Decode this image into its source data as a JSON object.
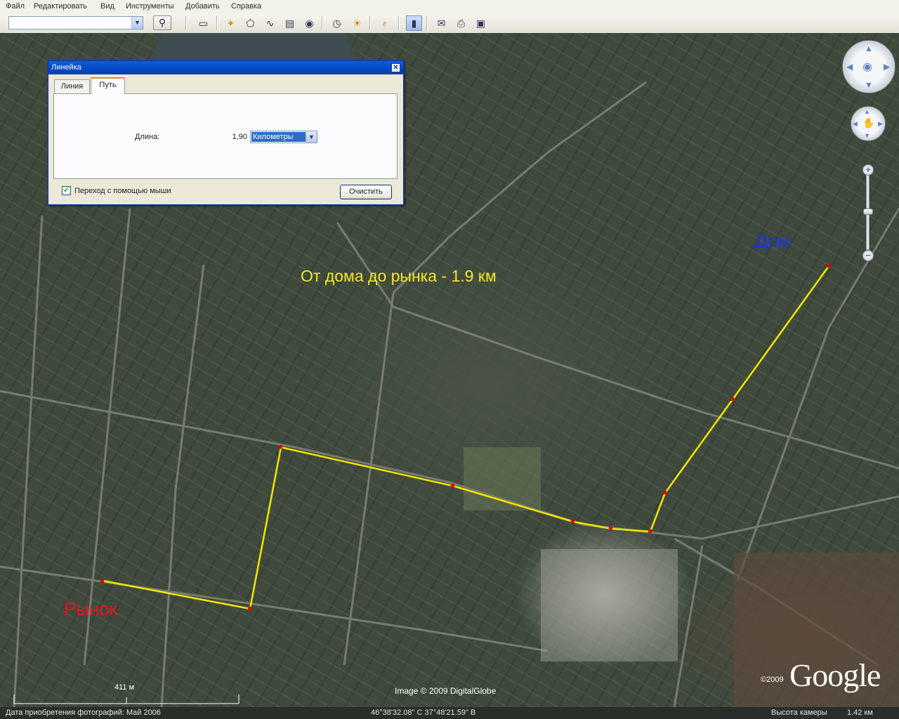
{
  "menu": [
    "Файл",
    "Редактировать",
    "Вид",
    "Инструменты",
    "Добавить",
    "Справка"
  ],
  "toolbar": {
    "search_value": "",
    "icons": [
      "sidebar-toggle-icon",
      "placemark-icon",
      "polygon-icon",
      "path-icon",
      "overlay-icon",
      "tour-icon",
      "historical-imagery-icon",
      "sunlight-icon",
      "planet-switch-icon",
      "ruler-icon",
      "email-icon",
      "print-icon",
      "save-image-icon"
    ]
  },
  "map": {
    "labels": {
      "home": "Дом",
      "market": "Рынок",
      "distance_note": "От дома до рынка - 1.9 км"
    },
    "label_colors": {
      "home": "#1c32e6",
      "market": "#e8141c",
      "distance_note": "#f3e623",
      "path": "#f1e400",
      "path_point": "#e00000"
    },
    "scale_label": "411 м",
    "imagery_credit": "Image © 2009 DigitalGlobe",
    "copyright_year": "©2009",
    "logo": "Google"
  },
  "ruler_dialog": {
    "title": "Линейка",
    "tabs": [
      "Линия",
      "Путь"
    ],
    "active_tab": "Путь",
    "length_label": "Длина:",
    "length_value": "1,90",
    "unit": "Километры",
    "mouse_navigation_label": "Переход с помощью мыши",
    "mouse_navigation_checked": true,
    "clear_button": "Очистить"
  },
  "status": {
    "imagery_date": "Дата приобретения фотографий: Май 2006",
    "coordinates": "46°38'32.08\" С     37°48'21.59\" В",
    "eye_alt_label": "Высота камеры",
    "eye_alt_value": "1.42 км"
  }
}
